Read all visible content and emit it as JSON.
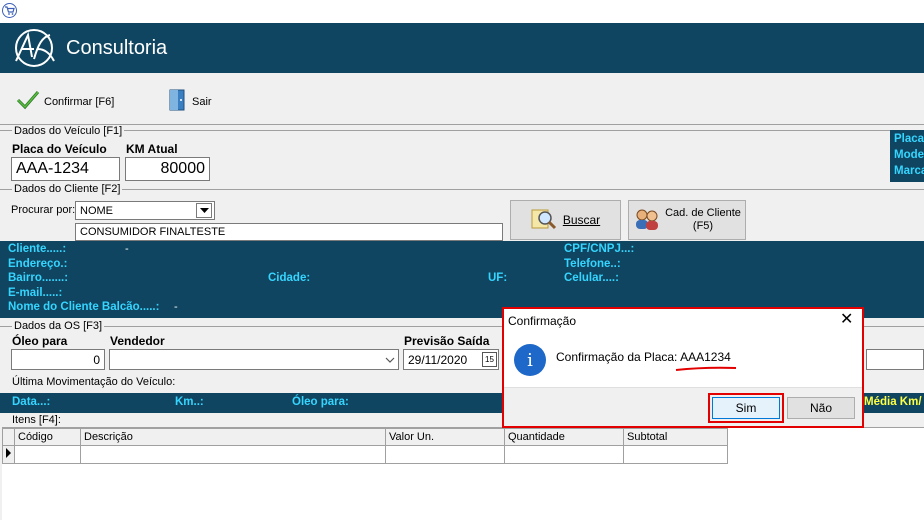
{
  "app": {
    "title": "Consultoria"
  },
  "toolbar": {
    "confirm_label": "Confirmar [F6]",
    "exit_label": "Sair"
  },
  "vehicle": {
    "group_label": "Dados do Veículo [F1]",
    "plate_label": "Placa do Veículo",
    "plate_value": "AAA-1234",
    "km_label": "KM Atual",
    "km_value": "80000",
    "side_labels": [
      "Placa",
      "Mode",
      "Marca"
    ]
  },
  "client": {
    "group_label": "Dados do Cliente [F2]",
    "search_label": "Procurar por:",
    "search_by": "NOME",
    "name_value": "CONSUMIDOR FINALTESTE",
    "search_button": "Buscar",
    "register_button_line1": "Cad. de Cliente",
    "register_button_line2": "(F5)",
    "info": {
      "cliente_label": "Cliente.....:",
      "cliente_value": "-",
      "endereco_label": "Endereço.:",
      "bairro_label": "Bairro.......:",
      "email_label": "E-mail.....:",
      "balcao_label": "Nome do Cliente Balcão.....:",
      "balcao_value": "-",
      "cidade_label": "Cidade:",
      "uf_label": "UF:",
      "cpf_label": "CPF/CNPJ...:",
      "telefone_label": "Telefone..:",
      "celular_label": "Celular....:"
    }
  },
  "os": {
    "group_label": "Dados da OS [F3]",
    "oleo_label": "Óleo para",
    "oleo_value": "0",
    "vendedor_label": "Vendedor",
    "previsao_label": "Previsão Saída",
    "previsao_value": "29/11/2020",
    "calendar_glyph": "15"
  },
  "last_movement": {
    "label": "Última Movimentação do Veículo:",
    "data_label": "Data...:",
    "km_label": "Km..:",
    "oleo_label": "Óleo para:",
    "media_label": "Média Km/"
  },
  "items": {
    "group_label": "Itens [F4]:",
    "columns": [
      "Código",
      "Descrição",
      "Valor Un.",
      "Quantidade",
      "Subtotal"
    ]
  },
  "dialog": {
    "title": "Confirmação",
    "close_glyph": "✕",
    "info_glyph": "i",
    "message_prefix": "Confirmação da Placa: ",
    "plate": "AAA1234",
    "yes_label": "Sim",
    "no_label": "Não"
  },
  "colors": {
    "banner": "#0f4560",
    "band_text": "#35d5ff",
    "highlight": "#e30000"
  }
}
